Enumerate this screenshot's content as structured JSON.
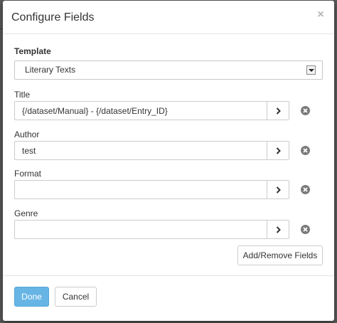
{
  "dialog": {
    "title": "Configure Fields",
    "close_glyph": "×"
  },
  "template": {
    "label": "Template",
    "selected": "Literary Texts"
  },
  "fields": [
    {
      "label": "Title",
      "value": "{/dataset/Manual} - {/dataset/Entry_ID}"
    },
    {
      "label": "Author",
      "value": "test"
    },
    {
      "label": "Format",
      "value": ""
    },
    {
      "label": "Genre",
      "value": ""
    }
  ],
  "buttons": {
    "add_remove": "Add/Remove Fields",
    "done": "Done",
    "cancel": "Cancel"
  },
  "icons": {
    "arrow": "chevron-right-icon",
    "remove": "remove-circle-icon",
    "close": "close-icon",
    "dropdown": "dropdown-arrow-icon"
  },
  "colors": {
    "primary": "#67b5e5",
    "remove_icon": "#7a7a7a",
    "backdrop": "#5a5a5a"
  }
}
